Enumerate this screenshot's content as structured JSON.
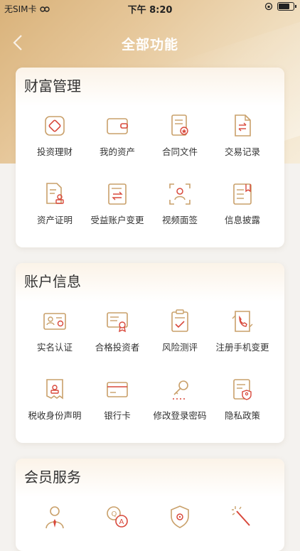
{
  "status": {
    "carrier": "无SIM卡",
    "time": "下午 8:20"
  },
  "nav": {
    "title": "全部功能"
  },
  "sections": [
    {
      "title": "财富管理",
      "items": [
        {
          "label": "投资理财",
          "icon": "coin-icon"
        },
        {
          "label": "我的资产",
          "icon": "wallet-icon"
        },
        {
          "label": "合同文件",
          "icon": "contract-icon"
        },
        {
          "label": "交易记录",
          "icon": "transaction-record-icon"
        },
        {
          "label": "资产证明",
          "icon": "asset-certificate-icon"
        },
        {
          "label": "受益账户变更",
          "icon": "account-change-icon"
        },
        {
          "label": "视频面签",
          "icon": "video-sign-icon"
        },
        {
          "label": "信息披露",
          "icon": "info-disclosure-icon"
        }
      ]
    },
    {
      "title": "账户信息",
      "items": [
        {
          "label": "实名认证",
          "icon": "id-card-icon"
        },
        {
          "label": "合格投资者",
          "icon": "qualified-investor-icon"
        },
        {
          "label": "风险测评",
          "icon": "risk-assessment-icon"
        },
        {
          "label": "注册手机变更",
          "icon": "phone-change-icon"
        },
        {
          "label": "税收身份声明",
          "icon": "tax-declaration-icon"
        },
        {
          "label": "银行卡",
          "icon": "bank-card-icon"
        },
        {
          "label": "修改登录密码",
          "icon": "key-icon"
        },
        {
          "label": "隐私政策",
          "icon": "privacy-policy-icon"
        }
      ]
    },
    {
      "title": "会员服务",
      "items": [
        {
          "label": "",
          "icon": "advisor-icon"
        },
        {
          "label": "",
          "icon": "qa-icon"
        },
        {
          "label": "",
          "icon": "shield-gear-icon"
        },
        {
          "label": "",
          "icon": "magic-wand-icon"
        }
      ]
    }
  ]
}
